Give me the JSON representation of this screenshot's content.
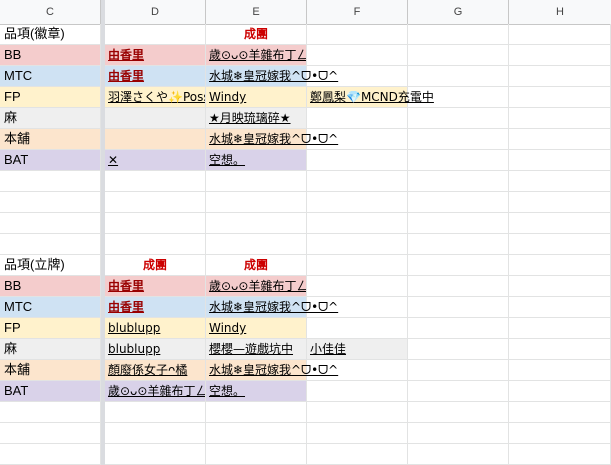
{
  "columns": [
    "C",
    "D",
    "E",
    "F",
    "G",
    "H"
  ],
  "section1": {
    "header_label": "品項(徽章)",
    "header_e": "成團",
    "rows": [
      {
        "label": "BB",
        "d": "由香里",
        "e": "歲⊙ᴗ⊙羊雜布丁ㄥ",
        "f": ""
      },
      {
        "label": "MTC",
        "d": "由香里",
        "e": "水城❄皇冠嫁我^ᗜ•ᗜ^",
        "f": ""
      },
      {
        "label": "FP",
        "d": "羽澤さくや✨Poss",
        "e": "Windy",
        "f": "鄭鳳梨💎MCND充電中"
      },
      {
        "label": "麻",
        "d": "",
        "e": "★月映琉璃碎★",
        "f": ""
      },
      {
        "label": "本舖",
        "d": "",
        "e": "水城❄皇冠嫁我^ᗜ•ᗜ^",
        "f": ""
      },
      {
        "label": "BAT",
        "d": "✕",
        "e": "空想。",
        "f": ""
      }
    ]
  },
  "section2": {
    "header_label": "品項(立牌)",
    "header_d": "成團",
    "header_e": "成團",
    "rows": [
      {
        "label": "BB",
        "d": "由香里",
        "e": "歲⊙ᴗ⊙羊雜布丁ㄥ",
        "f": ""
      },
      {
        "label": "MTC",
        "d": "由香里",
        "e": "水城❄皇冠嫁我^ᗜ•ᗜ^",
        "f": ""
      },
      {
        "label": "FP",
        "d": "blublupp",
        "e": "Windy",
        "f": ""
      },
      {
        "label": "麻",
        "d": "blublupp",
        "e": "櫻櫻—遊戲坑中",
        "f": "小佳佳"
      },
      {
        "label": "本舖",
        "d": "顏廢係女子ᴖ橘",
        "e": "水城❄皇冠嫁我^ᗜ•ᗜ^",
        "f": ""
      },
      {
        "label": "BAT",
        "d": "歲⊙ᴗ⊙羊雜布丁ㄥ",
        "e": "空想。",
        "f": ""
      }
    ]
  }
}
